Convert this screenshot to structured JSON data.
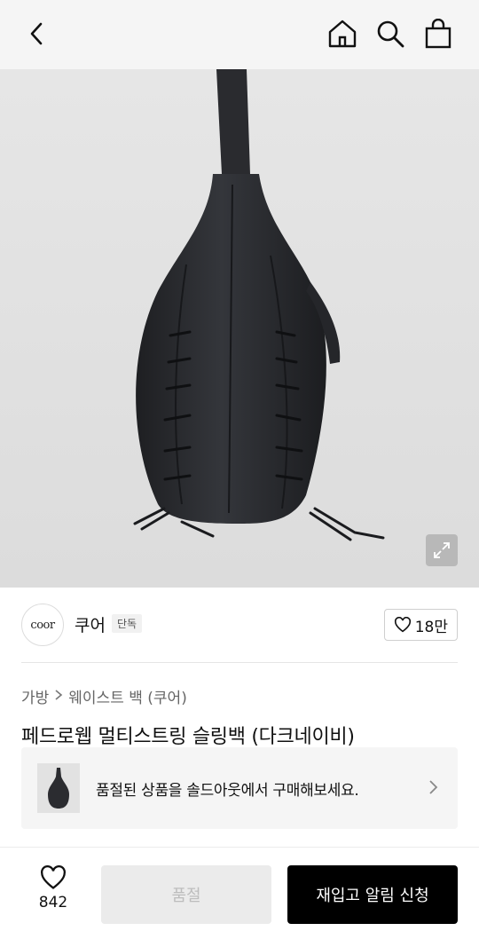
{
  "header": {
    "back_icon": "chevron-left-icon",
    "home_icon": "home-icon",
    "search_icon": "search-icon",
    "cart_icon": "shopping-bag-icon"
  },
  "hero": {
    "expand_icon": "expand-icon",
    "background": "#dfdfdf"
  },
  "brand": {
    "logo_text": "coor",
    "name": "쿠어",
    "tag": "단독",
    "likes": "18만"
  },
  "breadcrumb": {
    "items": [
      "가방",
      "웨이스트 백 (쿠어)"
    ]
  },
  "product": {
    "title": "페드로웹 멀티스트링 슬링백 (다크네이비)"
  },
  "soldout_banner": {
    "text": "품절된 상품을 솔드아웃에서 구매해보세요."
  },
  "bottom_bar": {
    "wish_count": "842",
    "soldout_label": "품절",
    "restock_label": "재입고 알림 신청"
  },
  "colors": {
    "topbar_bg": "#f5f5f5",
    "primary_button": "#000000",
    "disabled_button": "#ebebeb",
    "banner_bg": "#f5f5f5"
  }
}
